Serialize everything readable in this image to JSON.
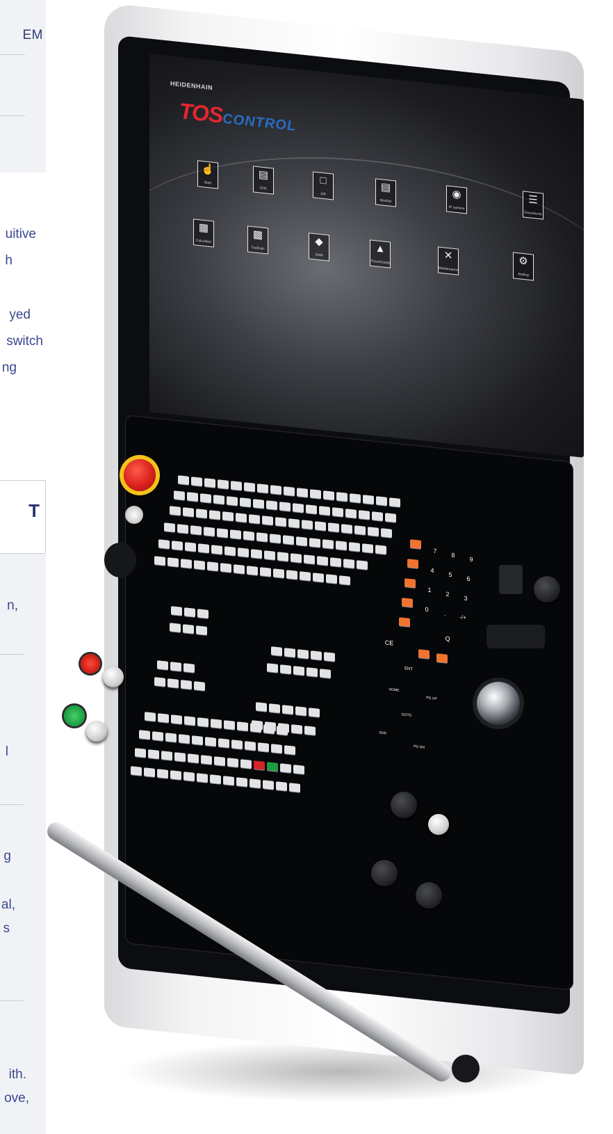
{
  "left_column": {
    "box1_text": "EM",
    "frag1": "uitive",
    "frag2": "h",
    "frag3": "yed",
    "frag4": "switch",
    "frag5": "ng",
    "box2_text": "T",
    "frag6": "n,",
    "frag7": "l",
    "frag8": "g",
    "frag9": "al,",
    "frag10": "s",
    "frag11": "ith.",
    "frag12": "ove,"
  },
  "screen": {
    "brand": "HEIDENHAIN",
    "logo_tos": "TOS",
    "logo_control": "CONTROL",
    "apps": [
      {
        "label": "Start",
        "icon": "cursor-click-icon"
      },
      {
        "label": "CNC",
        "icon": "monitor-icon"
      },
      {
        "label": "Job",
        "icon": "folder-icon"
      },
      {
        "label": "Monitor",
        "icon": "bar-chart-icon"
      },
      {
        "label": "IP camera",
        "icon": "camera-icon"
      },
      {
        "label": "Documents",
        "icon": "document-icon"
      },
      {
        "label": "Calculator",
        "icon": "calculator-icon"
      },
      {
        "label": "ToolCalc",
        "icon": "tool-calc-icon"
      },
      {
        "label": "DAM",
        "icon": "spindle-icon"
      },
      {
        "label": "ThermComp",
        "icon": "thermometer-icon"
      },
      {
        "label": "Maintenance",
        "icon": "wrench-icon"
      },
      {
        "label": "Setting",
        "icon": "gear-icon"
      }
    ]
  },
  "keypad": {
    "digits_row1": [
      "7",
      "8",
      "9"
    ],
    "digits_row2": [
      "4",
      "5",
      "6"
    ],
    "digits_row3": [
      "1",
      "2",
      "3"
    ],
    "digits_row4": [
      "0",
      ".",
      "-/+"
    ],
    "ce": "CE",
    "q": "Q",
    "ent": "ENT",
    "home": "HOME",
    "end": "END",
    "pgup": "PG UP",
    "pgdn": "PG DN",
    "goto": "GOTO"
  },
  "colors": {
    "accent_navy": "#2d3a78",
    "orange_key": "#f07330",
    "estop_red": "#d9201c",
    "start_green": "#1e9b45"
  }
}
